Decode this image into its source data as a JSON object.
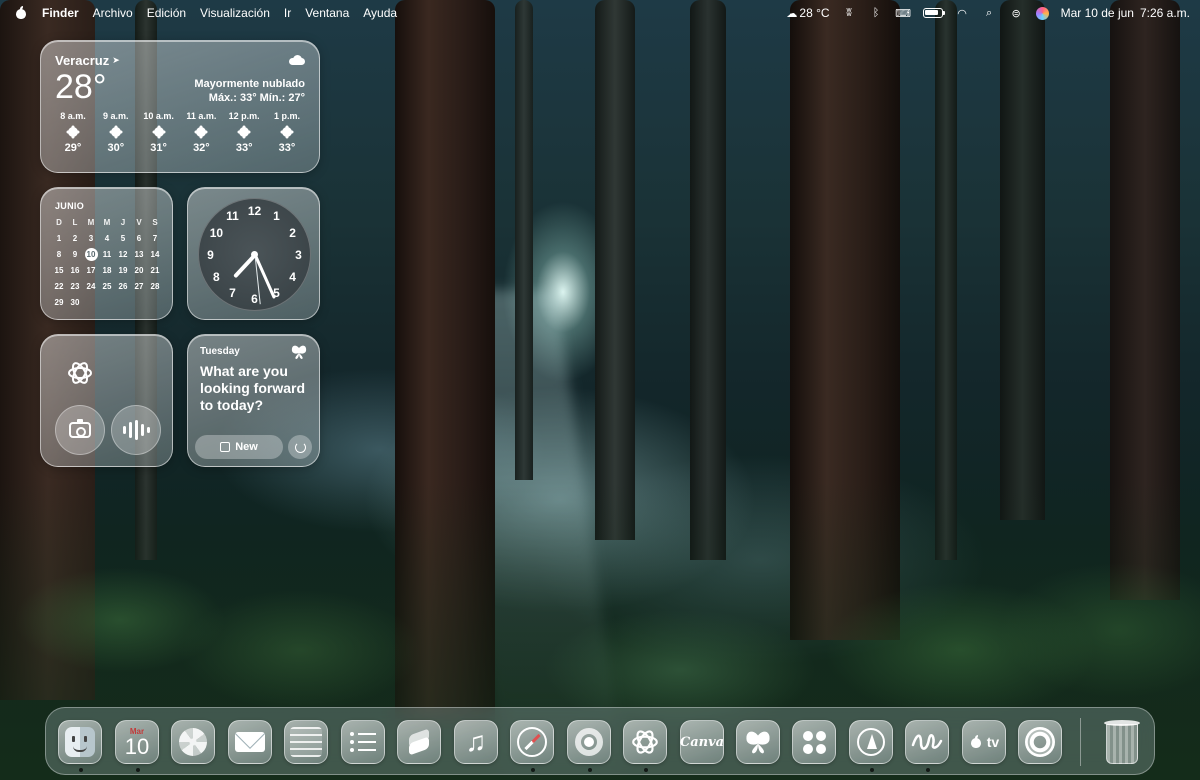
{
  "menubar": {
    "app_name": "Finder",
    "menus": [
      "Archivo",
      "Edición",
      "Visualización",
      "Ir",
      "Ventana",
      "Ayuda"
    ],
    "weather": "28 °C",
    "status_icons": [
      "cloud-icon",
      "accessibility-icon",
      "bluetooth-icon",
      "keyboard-icon",
      "battery-icon",
      "wifi-icon",
      "spotlight-icon",
      "control-center-icon",
      "siri-icon"
    ],
    "date": "Mar 10 de jun",
    "time": "7:26 a.m."
  },
  "weather_widget": {
    "location": "Veracruz",
    "temperature": "28°",
    "condition": "Mayormente nublado",
    "high_low": "Máx.: 33° Mín.: 27°",
    "hours": [
      {
        "time": "8 a.m.",
        "temp": "29°"
      },
      {
        "time": "9 a.m.",
        "temp": "30°"
      },
      {
        "time": "10 a.m.",
        "temp": "31°"
      },
      {
        "time": "11 a.m.",
        "temp": "32°"
      },
      {
        "time": "12 p.m.",
        "temp": "33°"
      },
      {
        "time": "1 p.m.",
        "temp": "33°"
      }
    ]
  },
  "calendar_widget": {
    "month": "JUNIO",
    "weekdays": [
      "D",
      "L",
      "M",
      "M",
      "J",
      "V",
      "S"
    ],
    "days": [
      "1",
      "2",
      "3",
      "4",
      "5",
      "6",
      "7",
      "8",
      "9",
      "10",
      "11",
      "12",
      "13",
      "14",
      "15",
      "16",
      "17",
      "18",
      "19",
      "20",
      "21",
      "22",
      "23",
      "24",
      "25",
      "26",
      "27",
      "28",
      "29",
      "30"
    ],
    "today": "10"
  },
  "clock_widget": {
    "numbers": [
      "12",
      "1",
      "2",
      "3",
      "4",
      "5",
      "6",
      "7",
      "8",
      "9",
      "10",
      "11"
    ],
    "hour": 7,
    "minute": 26,
    "second": 29
  },
  "chatgpt_widget": {
    "icons": [
      "chatgpt-logo-icon",
      "camera-icon",
      "voice-icon"
    ]
  },
  "journal_widget": {
    "day": "Tuesday",
    "prompt": "What are you looking forward to today?",
    "new_label": "New"
  },
  "dock": {
    "calendar_month": "Mar",
    "calendar_day": "10",
    "canva_label": "Canva",
    "tv_label": "tv",
    "apps": [
      "Finder",
      "Calendario",
      "Fotos",
      "Mail",
      "Notas",
      "Recordatorios",
      "Atajos",
      "Música",
      "Safari",
      "Chrome",
      "ChatGPT",
      "Canva",
      "Diario",
      "Herramientas",
      "TestFlight",
      "Freeform",
      "Apple TV",
      "Configuración",
      "Papelera"
    ]
  }
}
